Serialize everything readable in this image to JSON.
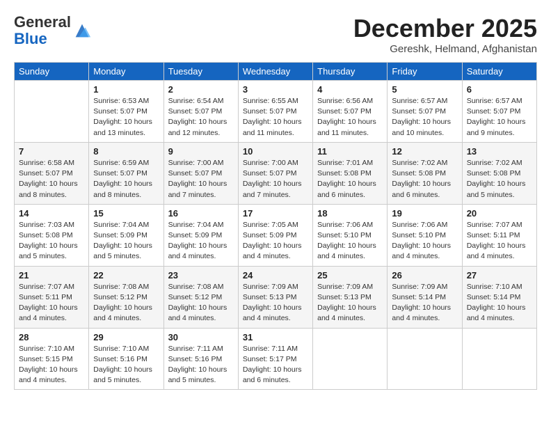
{
  "header": {
    "logo_line1": "General",
    "logo_line2": "Blue",
    "month": "December 2025",
    "location": "Gereshk, Helmand, Afghanistan"
  },
  "weekdays": [
    "Sunday",
    "Monday",
    "Tuesday",
    "Wednesday",
    "Thursday",
    "Friday",
    "Saturday"
  ],
  "weeks": [
    [
      {
        "day": "",
        "info": ""
      },
      {
        "day": "1",
        "info": "Sunrise: 6:53 AM\nSunset: 5:07 PM\nDaylight: 10 hours\nand 13 minutes."
      },
      {
        "day": "2",
        "info": "Sunrise: 6:54 AM\nSunset: 5:07 PM\nDaylight: 10 hours\nand 12 minutes."
      },
      {
        "day": "3",
        "info": "Sunrise: 6:55 AM\nSunset: 5:07 PM\nDaylight: 10 hours\nand 11 minutes."
      },
      {
        "day": "4",
        "info": "Sunrise: 6:56 AM\nSunset: 5:07 PM\nDaylight: 10 hours\nand 11 minutes."
      },
      {
        "day": "5",
        "info": "Sunrise: 6:57 AM\nSunset: 5:07 PM\nDaylight: 10 hours\nand 10 minutes."
      },
      {
        "day": "6",
        "info": "Sunrise: 6:57 AM\nSunset: 5:07 PM\nDaylight: 10 hours\nand 9 minutes."
      }
    ],
    [
      {
        "day": "7",
        "info": "Sunrise: 6:58 AM\nSunset: 5:07 PM\nDaylight: 10 hours\nand 8 minutes."
      },
      {
        "day": "8",
        "info": "Sunrise: 6:59 AM\nSunset: 5:07 PM\nDaylight: 10 hours\nand 8 minutes."
      },
      {
        "day": "9",
        "info": "Sunrise: 7:00 AM\nSunset: 5:07 PM\nDaylight: 10 hours\nand 7 minutes."
      },
      {
        "day": "10",
        "info": "Sunrise: 7:00 AM\nSunset: 5:07 PM\nDaylight: 10 hours\nand 7 minutes."
      },
      {
        "day": "11",
        "info": "Sunrise: 7:01 AM\nSunset: 5:08 PM\nDaylight: 10 hours\nand 6 minutes."
      },
      {
        "day": "12",
        "info": "Sunrise: 7:02 AM\nSunset: 5:08 PM\nDaylight: 10 hours\nand 6 minutes."
      },
      {
        "day": "13",
        "info": "Sunrise: 7:02 AM\nSunset: 5:08 PM\nDaylight: 10 hours\nand 5 minutes."
      }
    ],
    [
      {
        "day": "14",
        "info": "Sunrise: 7:03 AM\nSunset: 5:08 PM\nDaylight: 10 hours\nand 5 minutes."
      },
      {
        "day": "15",
        "info": "Sunrise: 7:04 AM\nSunset: 5:09 PM\nDaylight: 10 hours\nand 5 minutes."
      },
      {
        "day": "16",
        "info": "Sunrise: 7:04 AM\nSunset: 5:09 PM\nDaylight: 10 hours\nand 4 minutes."
      },
      {
        "day": "17",
        "info": "Sunrise: 7:05 AM\nSunset: 5:09 PM\nDaylight: 10 hours\nand 4 minutes."
      },
      {
        "day": "18",
        "info": "Sunrise: 7:06 AM\nSunset: 5:10 PM\nDaylight: 10 hours\nand 4 minutes."
      },
      {
        "day": "19",
        "info": "Sunrise: 7:06 AM\nSunset: 5:10 PM\nDaylight: 10 hours\nand 4 minutes."
      },
      {
        "day": "20",
        "info": "Sunrise: 7:07 AM\nSunset: 5:11 PM\nDaylight: 10 hours\nand 4 minutes."
      }
    ],
    [
      {
        "day": "21",
        "info": "Sunrise: 7:07 AM\nSunset: 5:11 PM\nDaylight: 10 hours\nand 4 minutes."
      },
      {
        "day": "22",
        "info": "Sunrise: 7:08 AM\nSunset: 5:12 PM\nDaylight: 10 hours\nand 4 minutes."
      },
      {
        "day": "23",
        "info": "Sunrise: 7:08 AM\nSunset: 5:12 PM\nDaylight: 10 hours\nand 4 minutes."
      },
      {
        "day": "24",
        "info": "Sunrise: 7:09 AM\nSunset: 5:13 PM\nDaylight: 10 hours\nand 4 minutes."
      },
      {
        "day": "25",
        "info": "Sunrise: 7:09 AM\nSunset: 5:13 PM\nDaylight: 10 hours\nand 4 minutes."
      },
      {
        "day": "26",
        "info": "Sunrise: 7:09 AM\nSunset: 5:14 PM\nDaylight: 10 hours\nand 4 minutes."
      },
      {
        "day": "27",
        "info": "Sunrise: 7:10 AM\nSunset: 5:14 PM\nDaylight: 10 hours\nand 4 minutes."
      }
    ],
    [
      {
        "day": "28",
        "info": "Sunrise: 7:10 AM\nSunset: 5:15 PM\nDaylight: 10 hours\nand 4 minutes."
      },
      {
        "day": "29",
        "info": "Sunrise: 7:10 AM\nSunset: 5:16 PM\nDaylight: 10 hours\nand 5 minutes."
      },
      {
        "day": "30",
        "info": "Sunrise: 7:11 AM\nSunset: 5:16 PM\nDaylight: 10 hours\nand 5 minutes."
      },
      {
        "day": "31",
        "info": "Sunrise: 7:11 AM\nSunset: 5:17 PM\nDaylight: 10 hours\nand 6 minutes."
      },
      {
        "day": "",
        "info": ""
      },
      {
        "day": "",
        "info": ""
      },
      {
        "day": "",
        "info": ""
      }
    ]
  ]
}
